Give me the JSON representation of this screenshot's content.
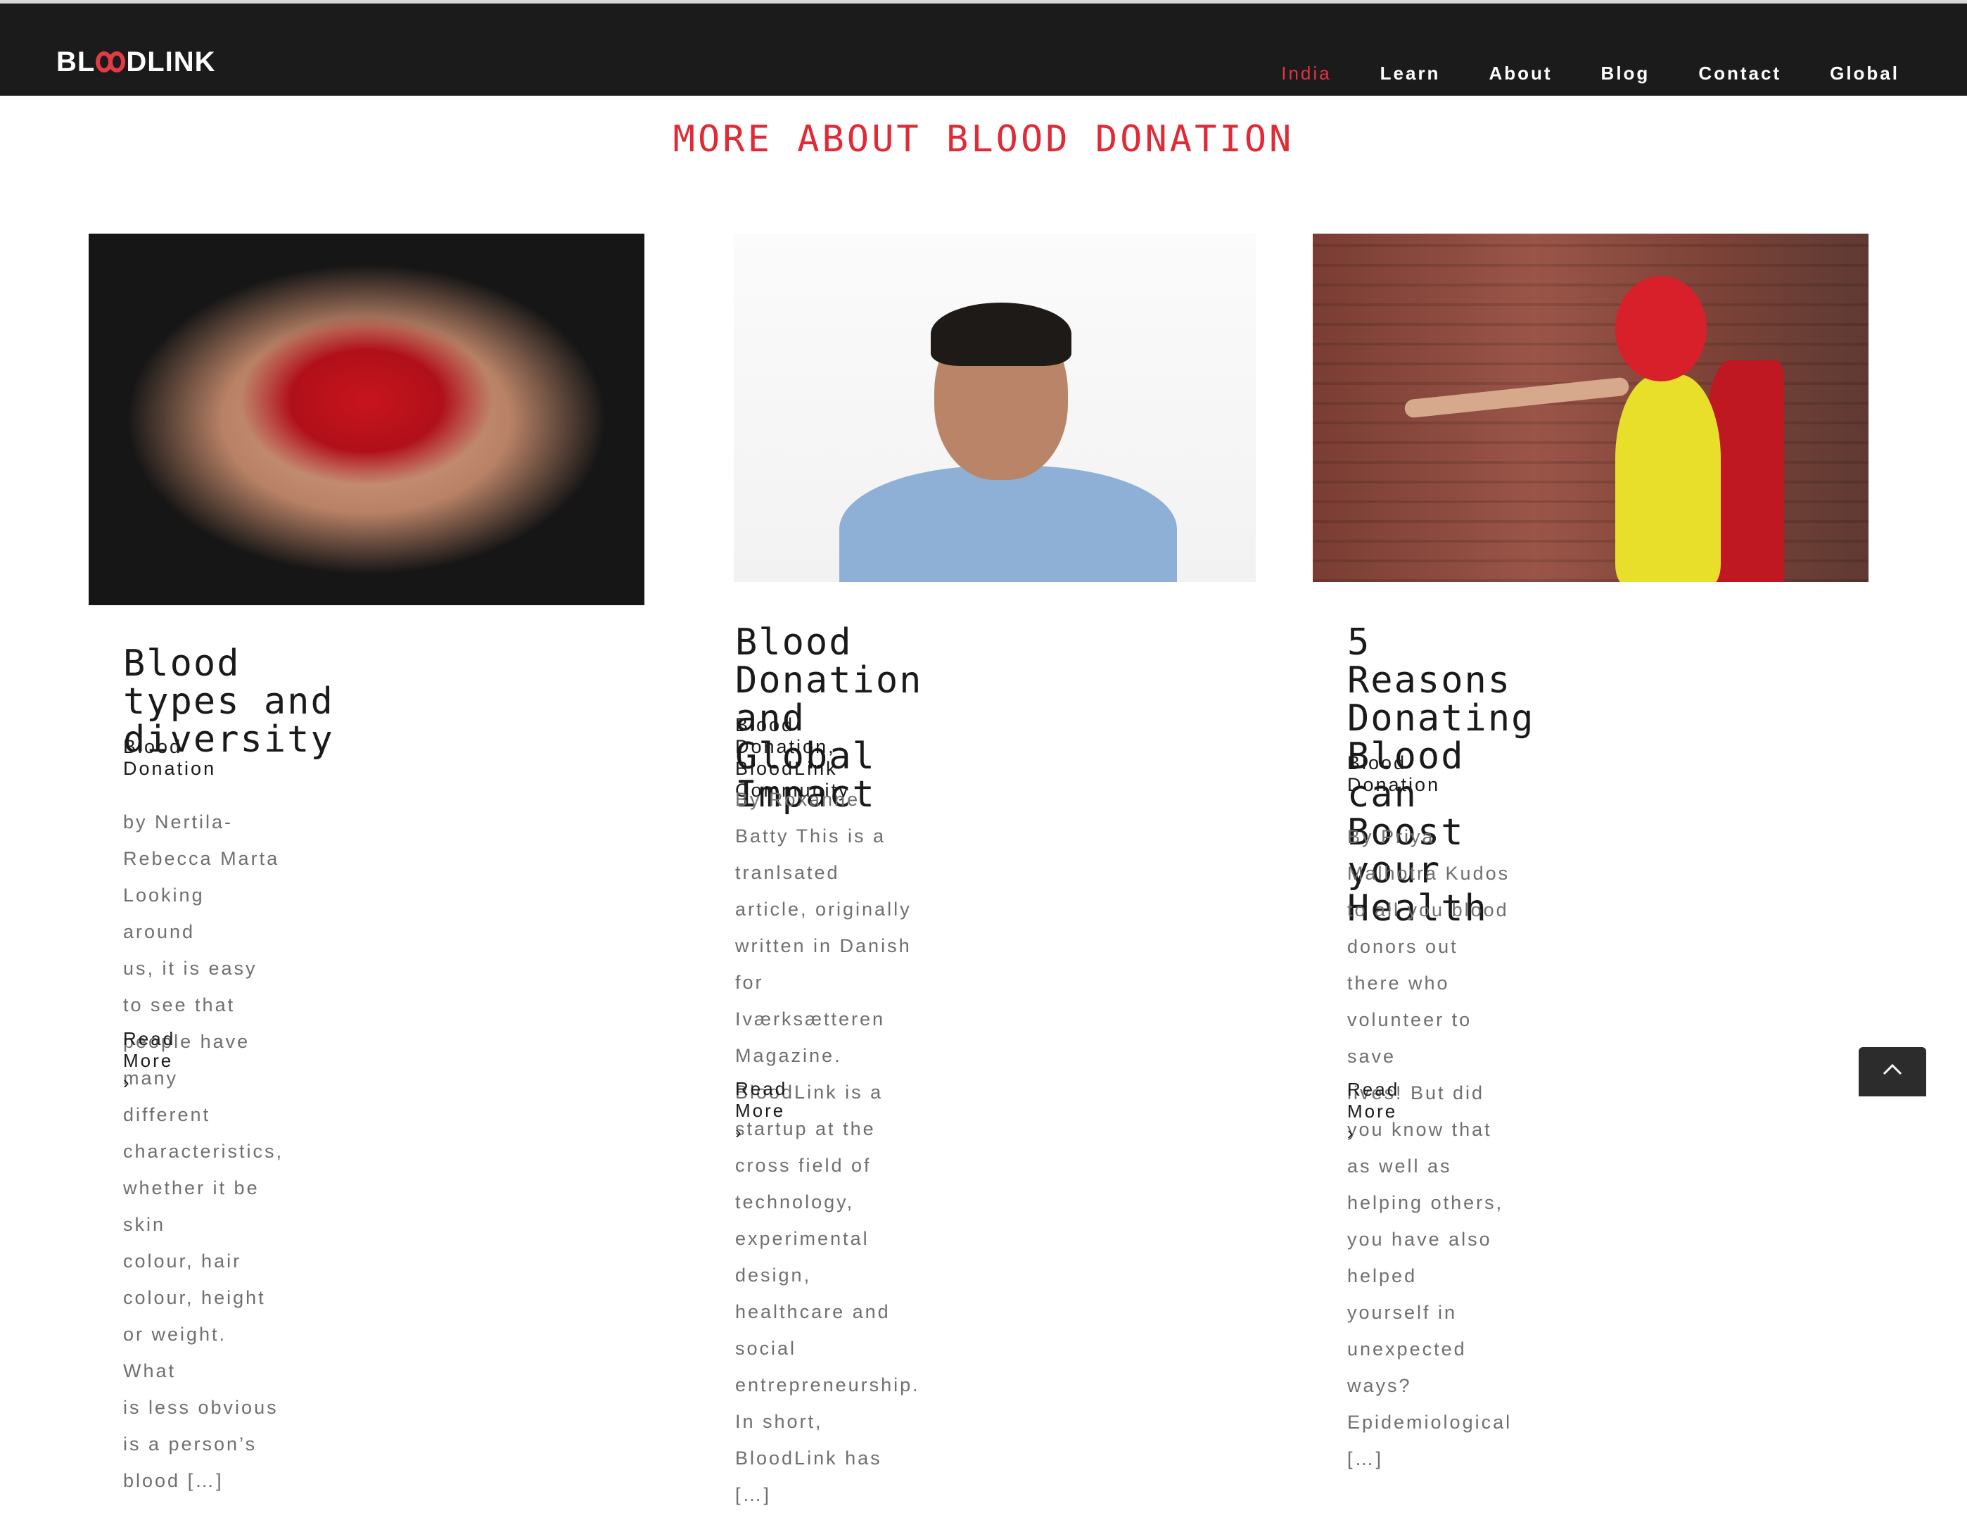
{
  "header": {
    "logo_text_left": "BL",
    "logo_text_right": "DLINK",
    "nav": [
      {
        "label": "India",
        "active": true
      },
      {
        "label": "Learn",
        "active": false
      },
      {
        "label": "About",
        "active": false
      },
      {
        "label": "Blog",
        "active": false
      },
      {
        "label": "Contact",
        "active": false
      },
      {
        "label": "Global",
        "active": false
      }
    ]
  },
  "section": {
    "title": "MORE ABOUT BLOOD DONATION"
  },
  "posts": [
    {
      "title_line1": "Blood types and",
      "title_line2": "diversity",
      "categories": [
        "Blood Donation"
      ],
      "excerpt": [
        "by Nertila-Rebecca Marta Looking around",
        "us, it is easy to see that people have many",
        "different characteristics, whether it be skin",
        "colour, hair colour, height or weight. What",
        "is less obvious is a person’s blood […]"
      ],
      "read_more": "Read More"
    },
    {
      "title_line1": "Blood Donation and",
      "title_line2": "Global Impact",
      "categories": [
        "Blood Donation",
        "BloodLink Community"
      ],
      "excerpt": [
        "By Roxanne Batty This is a tranlsated",
        "article, originally written in Danish for",
        "Iværksætteren Magazine. BloodLink is a",
        "startup at the cross field of technology,",
        "experimental design, healthcare and social",
        "entrepreneurship. In short, BloodLink has",
        "[…]"
      ],
      "read_more": "Read More"
    },
    {
      "title_line1": "5 Reasons Donating",
      "title_line2": "Blood can Boost your",
      "title_line3": "Health",
      "categories": [
        "Blood Donation"
      ],
      "excerpt": [
        "By Priya Malhotra Kudos to all you blood",
        "donors out there who volunteer to save",
        "lives! But did you know that as well as",
        "helping others, you have also helped",
        "yourself in unexpected ways?",
        "Epidemiological […]"
      ],
      "read_more": "Read More"
    }
  ],
  "colors": {
    "accent": "#e02a37",
    "header_bg": "#1b1b1b"
  }
}
